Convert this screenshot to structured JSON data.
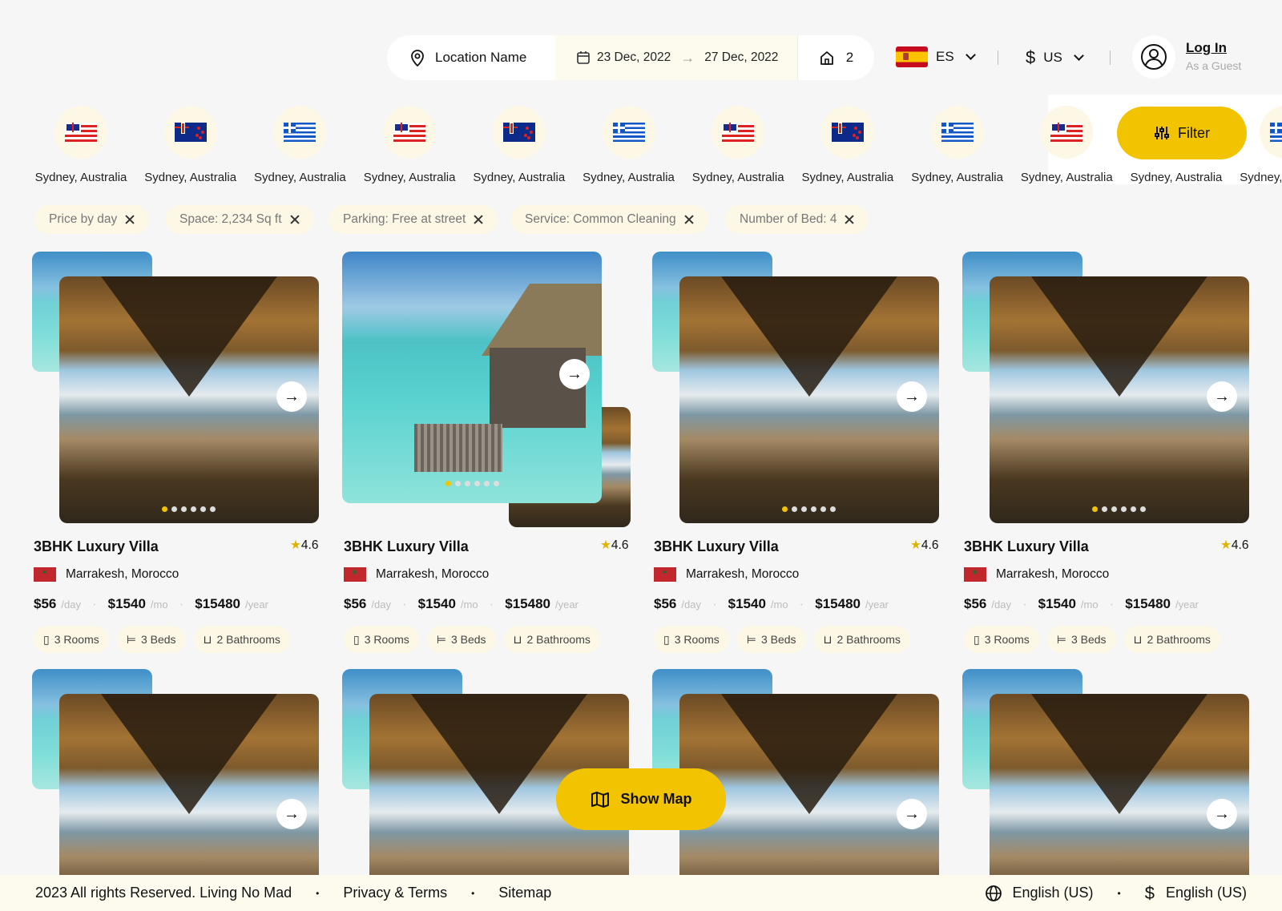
{
  "search": {
    "location": "Location Name",
    "date_from": "23 Dec, 2022",
    "date_to": "27 Dec, 2022",
    "rooms": "2"
  },
  "header": {
    "language": "ES",
    "currency": "US",
    "login_title": "Log In",
    "login_subtitle": "As a Guest"
  },
  "destinations": [
    {
      "label": "Sydney, Australia",
      "flag": "hawaii"
    },
    {
      "label": "Sydney, Australia",
      "flag": "new-zealand"
    },
    {
      "label": "Sydney, Australia",
      "flag": "greece"
    },
    {
      "label": "Sydney, Australia",
      "flag": "hawaii"
    },
    {
      "label": "Sydney, Australia",
      "flag": "new-zealand"
    },
    {
      "label": "Sydney, Australia",
      "flag": "greece"
    },
    {
      "label": "Sydney, Australia",
      "flag": "hawaii"
    },
    {
      "label": "Sydney, Australia",
      "flag": "new-zealand"
    },
    {
      "label": "Sydney, Australia",
      "flag": "greece"
    },
    {
      "label": "Sydney, Australia",
      "flag": "hawaii"
    },
    {
      "label": "Sydney, Australia",
      "flag": "new-zealand"
    },
    {
      "label": "Sydney, Australia",
      "flag": "greece"
    }
  ],
  "filter": {
    "label": "Filter"
  },
  "chips": [
    "Price by day",
    "Space: 2,234 Sq ft",
    "Parking: Free at street",
    "Service: Common Cleaning",
    "Number of Bed: 4"
  ],
  "listings": [
    {
      "title": "3BHK Luxury Villa",
      "rating": "4.6",
      "location": "Marrakesh, Morocco",
      "price_day": "$56",
      "unit_day": "/day",
      "price_mo": "$1540",
      "unit_mo": "/mo",
      "price_year": "$15480",
      "unit_year": "/year",
      "rooms": "3 Rooms",
      "beds": "3 Beds",
      "baths": "2 Bathrooms"
    },
    {
      "title": "3BHK Luxury Villa",
      "rating": "4.6",
      "location": "Marrakesh, Morocco",
      "price_day": "$56",
      "unit_day": "/day",
      "price_mo": "$1540",
      "unit_mo": "/mo",
      "price_year": "$15480",
      "unit_year": "/year",
      "rooms": "3 Rooms",
      "beds": "3 Beds",
      "baths": "2 Bathrooms"
    },
    {
      "title": "3BHK Luxury Villa",
      "rating": "4.6",
      "location": "Marrakesh, Morocco",
      "price_day": "$56",
      "unit_day": "/day",
      "price_mo": "$1540",
      "unit_mo": "/mo",
      "price_year": "$15480",
      "unit_year": "/year",
      "rooms": "3 Rooms",
      "beds": "3 Beds",
      "baths": "2 Bathrooms"
    },
    {
      "title": "3BHK Luxury Villa",
      "rating": "4.6",
      "location": "Marrakesh, Morocco",
      "price_day": "$56",
      "unit_day": "/day",
      "price_mo": "$1540",
      "unit_mo": "/mo",
      "price_year": "$15480",
      "unit_year": "/year",
      "rooms": "3 Rooms",
      "beds": "3 Beds",
      "baths": "2 Bathrooms"
    }
  ],
  "show_map": {
    "label": "Show Map"
  },
  "footer": {
    "copyright": "2023 All rights Reserved. Living No Mad",
    "privacy": "Privacy & Terms",
    "sitemap": "Sitemap",
    "language": "English (US)",
    "currency": "English (US)"
  },
  "colors": {
    "accent": "#f2c300",
    "chip_bg": "#fdf7e6",
    "page_bg": "#f6f6f6"
  }
}
